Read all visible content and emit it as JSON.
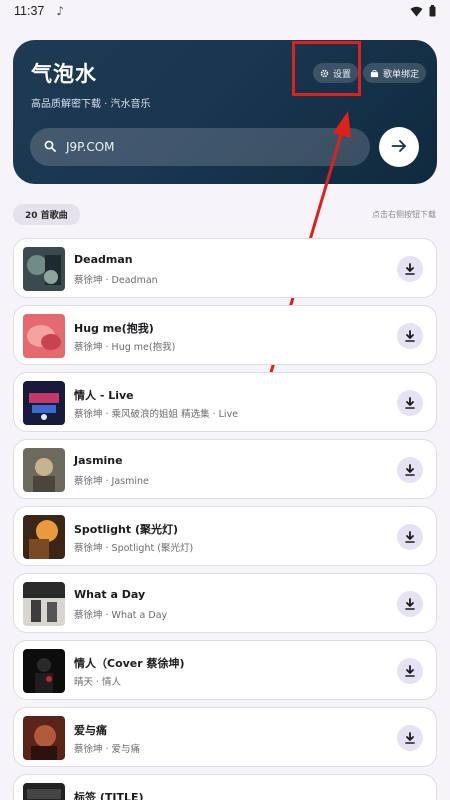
{
  "status_bar": {
    "time": "11:37"
  },
  "header": {
    "title": "气泡水",
    "subtitle": "高品质解密下载 · 汽水音乐",
    "settings_label": "设置",
    "playlist_bind_label": "歌单绑定",
    "search_value": "J9P.COM",
    "colors": {
      "card_bg": "#1a3650",
      "annotation": "#e0201a"
    }
  },
  "list": {
    "count_label": "20 首歌曲",
    "hint": "点击右侧按钮下载",
    "songs": [
      {
        "title": "Deadman",
        "meta": "蔡徐坤 · Deadman",
        "cover": "cover-deadman"
      },
      {
        "title": "Hug me(抱我)",
        "meta": "蔡徐坤 · Hug me(抱我)",
        "cover": "cover-hugme"
      },
      {
        "title": "情人 - Live",
        "meta": "蔡徐坤 · 乘风破浪的姐姐 精选集 · Live",
        "cover": "cover-live"
      },
      {
        "title": "Jasmine",
        "meta": "蔡徐坤 · Jasmine",
        "cover": "cover-jasmine"
      },
      {
        "title": "Spotlight (聚光灯)",
        "meta": "蔡徐坤 · Spotlight (聚光灯)",
        "cover": "cover-spotlight"
      },
      {
        "title": "What a Day",
        "meta": "蔡徐坤 · What a Day",
        "cover": "cover-whataday"
      },
      {
        "title": "情人（Cover 蔡徐坤)",
        "meta": "晴天 · 情人",
        "cover": "cover-qingren"
      },
      {
        "title": "爱与痛",
        "meta": "蔡徐坤 · 爱与痛",
        "cover": "cover-aiyutong"
      },
      {
        "title": "标签 (TITLE)",
        "meta": "",
        "cover": "cover-title"
      }
    ]
  }
}
